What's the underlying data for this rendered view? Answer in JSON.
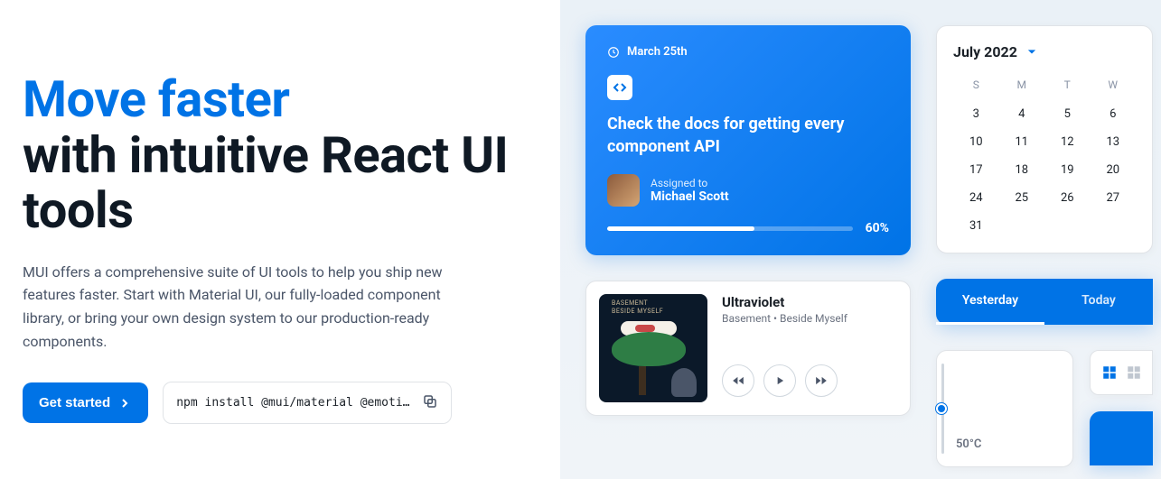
{
  "hero": {
    "title_blue": "Move faster",
    "title_rest": "with intuitive React UI tools",
    "description": "MUI offers a comprehensive suite of UI tools to help you ship new features faster. Start with Material UI, our fully-loaded component library, or bring your own design system to our production-ready components.",
    "cta_label": "Get started",
    "install_cmd": "npm install @mui/material @emotion..."
  },
  "task_card": {
    "date": "March 25th",
    "title": "Check the docs for getting every component API",
    "assigned_label": "Assigned to",
    "assignee_name": "Michael Scott",
    "progress_pct": "60%"
  },
  "music_card": {
    "album_line1": "BASEMENT",
    "album_line2": "BESIDE MYSELF",
    "track_title": "Ultraviolet",
    "track_sub": "Basement • Beside Myself"
  },
  "calendar": {
    "month_label": "July 2022",
    "dow": [
      "S",
      "M",
      "T",
      "W"
    ],
    "weeks": [
      [
        "3",
        "4",
        "5",
        "6"
      ],
      [
        "10",
        "11",
        "12",
        "13"
      ],
      [
        "17",
        "18",
        "19",
        "20"
      ],
      [
        "24",
        "25",
        "26",
        "27"
      ],
      [
        "31",
        "",
        "",
        ""
      ]
    ]
  },
  "tabs": {
    "items": [
      "Yesterday",
      "Today"
    ],
    "active_index": 0
  },
  "temperature": {
    "value": "50°C"
  }
}
